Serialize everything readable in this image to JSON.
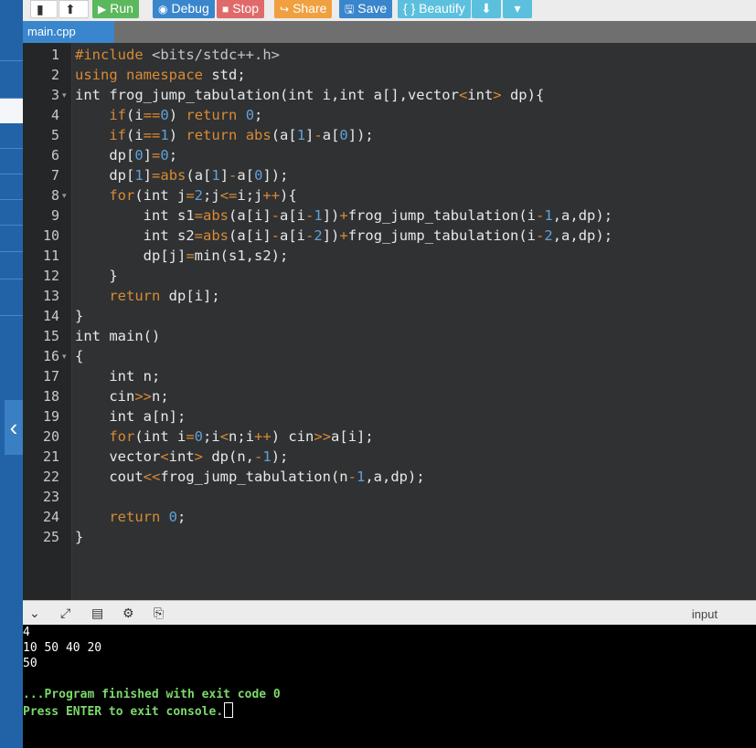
{
  "toolbar": {
    "run": "Run",
    "debug": "Debug",
    "stop": "Stop",
    "share": "Share",
    "save": "Save",
    "beautify": "{ } Beautify"
  },
  "tab": {
    "name": "main.cpp"
  },
  "editor": {
    "lines": [
      "1",
      "2",
      "3",
      "4",
      "5",
      "6",
      "7",
      "8",
      "9",
      "10",
      "11",
      "12",
      "13",
      "14",
      "15",
      "16",
      "17",
      "18",
      "19",
      "20",
      "21",
      "22",
      "23",
      "24",
      "25"
    ],
    "folds": [
      "3",
      "8",
      "16"
    ]
  },
  "console": {
    "input_label": "input",
    "lines": [
      "4",
      "10 50 40 20",
      "50",
      "",
      "...Program finished with exit code 0",
      "Press ENTER to exit console."
    ]
  },
  "colors": {
    "run": "#5cb85c",
    "debug": "#3a86cd",
    "stop": "#e06a6a",
    "share": "#f0a040",
    "save": "#3a86cd",
    "beautify": "#5bc0de",
    "download": "#5bc0de",
    "keyword": "#d98a34",
    "number": "#62a1d8"
  },
  "icons": [
    "file-icon",
    "upload-icon",
    "play-icon",
    "debug-icon",
    "stop-icon",
    "share-icon",
    "save-icon",
    "download-icon",
    "caret-down-icon",
    "chevron-down-icon",
    "expand-icon",
    "layout-icon",
    "gear-icon",
    "clipboard-icon",
    "chevron-left-icon"
  ]
}
